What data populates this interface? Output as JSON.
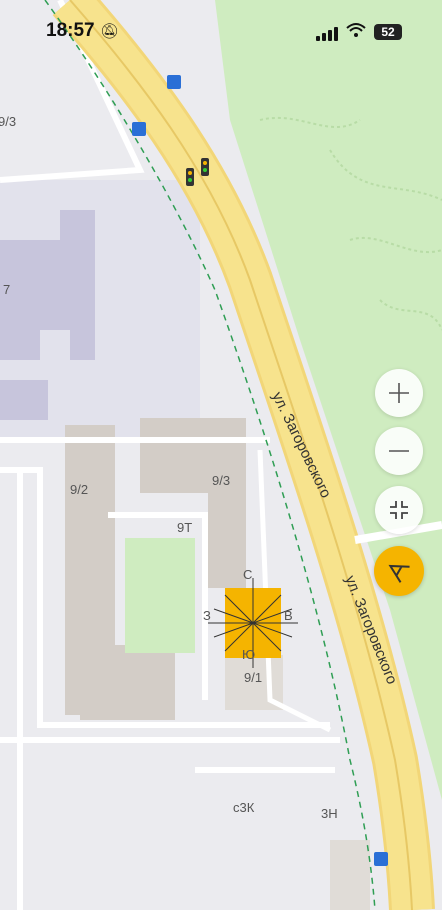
{
  "status_bar": {
    "time": "18:57",
    "battery": "52"
  },
  "colors": {
    "accent": "#f5b400",
    "park": "#cfecc0",
    "road": "#f7e38d",
    "building": "#d3cdc7"
  },
  "map": {
    "street_labels": [
      "ул. Загоровского",
      "ул. Загоровского"
    ],
    "building_labels": [
      "9/3",
      "9/2",
      "9/3",
      "9Т",
      "9/1",
      "с3К",
      "3Н",
      "7"
    ],
    "compass": {
      "north": "С",
      "east": "В",
      "south": "Ю",
      "west": "З"
    }
  },
  "controls": {
    "zoom_in_icon": "plus-icon",
    "zoom_out_icon": "minus-icon",
    "fit_icon": "collapse-icon",
    "nav_icon": "navigator-icon"
  }
}
